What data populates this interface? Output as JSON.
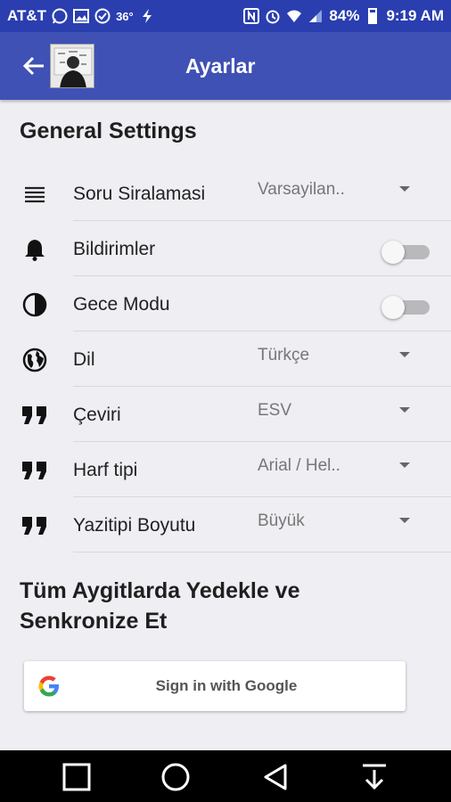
{
  "status_bar": {
    "carrier": "AT&T",
    "temperature": "36°",
    "battery": "84%",
    "time": "9:19 AM"
  },
  "app_bar": {
    "title": "Ayarlar"
  },
  "general": {
    "title": "General Settings",
    "rows": [
      {
        "label": "Soru Siralamasi",
        "value": "Varsayilan..",
        "icon": "list-icon",
        "control": "dropdown"
      },
      {
        "label": "Bildirimler",
        "value": "",
        "icon": "bell-icon",
        "control": "toggle",
        "on": false
      },
      {
        "label": "Gece Modu",
        "value": "",
        "icon": "contrast-icon",
        "control": "toggle",
        "on": false
      },
      {
        "label": "Dil",
        "value": "Türkçe",
        "icon": "globe-icon",
        "control": "dropdown"
      },
      {
        "label": "Çeviri",
        "value": "ESV",
        "icon": "quote-icon",
        "control": "dropdown"
      },
      {
        "label": "Harf tipi",
        "value": "Arial / Hel..",
        "icon": "quote-icon",
        "control": "dropdown"
      },
      {
        "label": "Yazitipi Boyutu",
        "value": "Büyük",
        "icon": "quote-icon",
        "control": "dropdown"
      }
    ]
  },
  "sync": {
    "title_line1": "Tüm Aygitlarda Yedekle ve",
    "title_line2": "Senkronize Et",
    "google_button": "Sign in with Google"
  },
  "colors": {
    "status_bar": "#2a3eb0",
    "app_bar": "#3f51b5",
    "background": "#eeeef3"
  }
}
